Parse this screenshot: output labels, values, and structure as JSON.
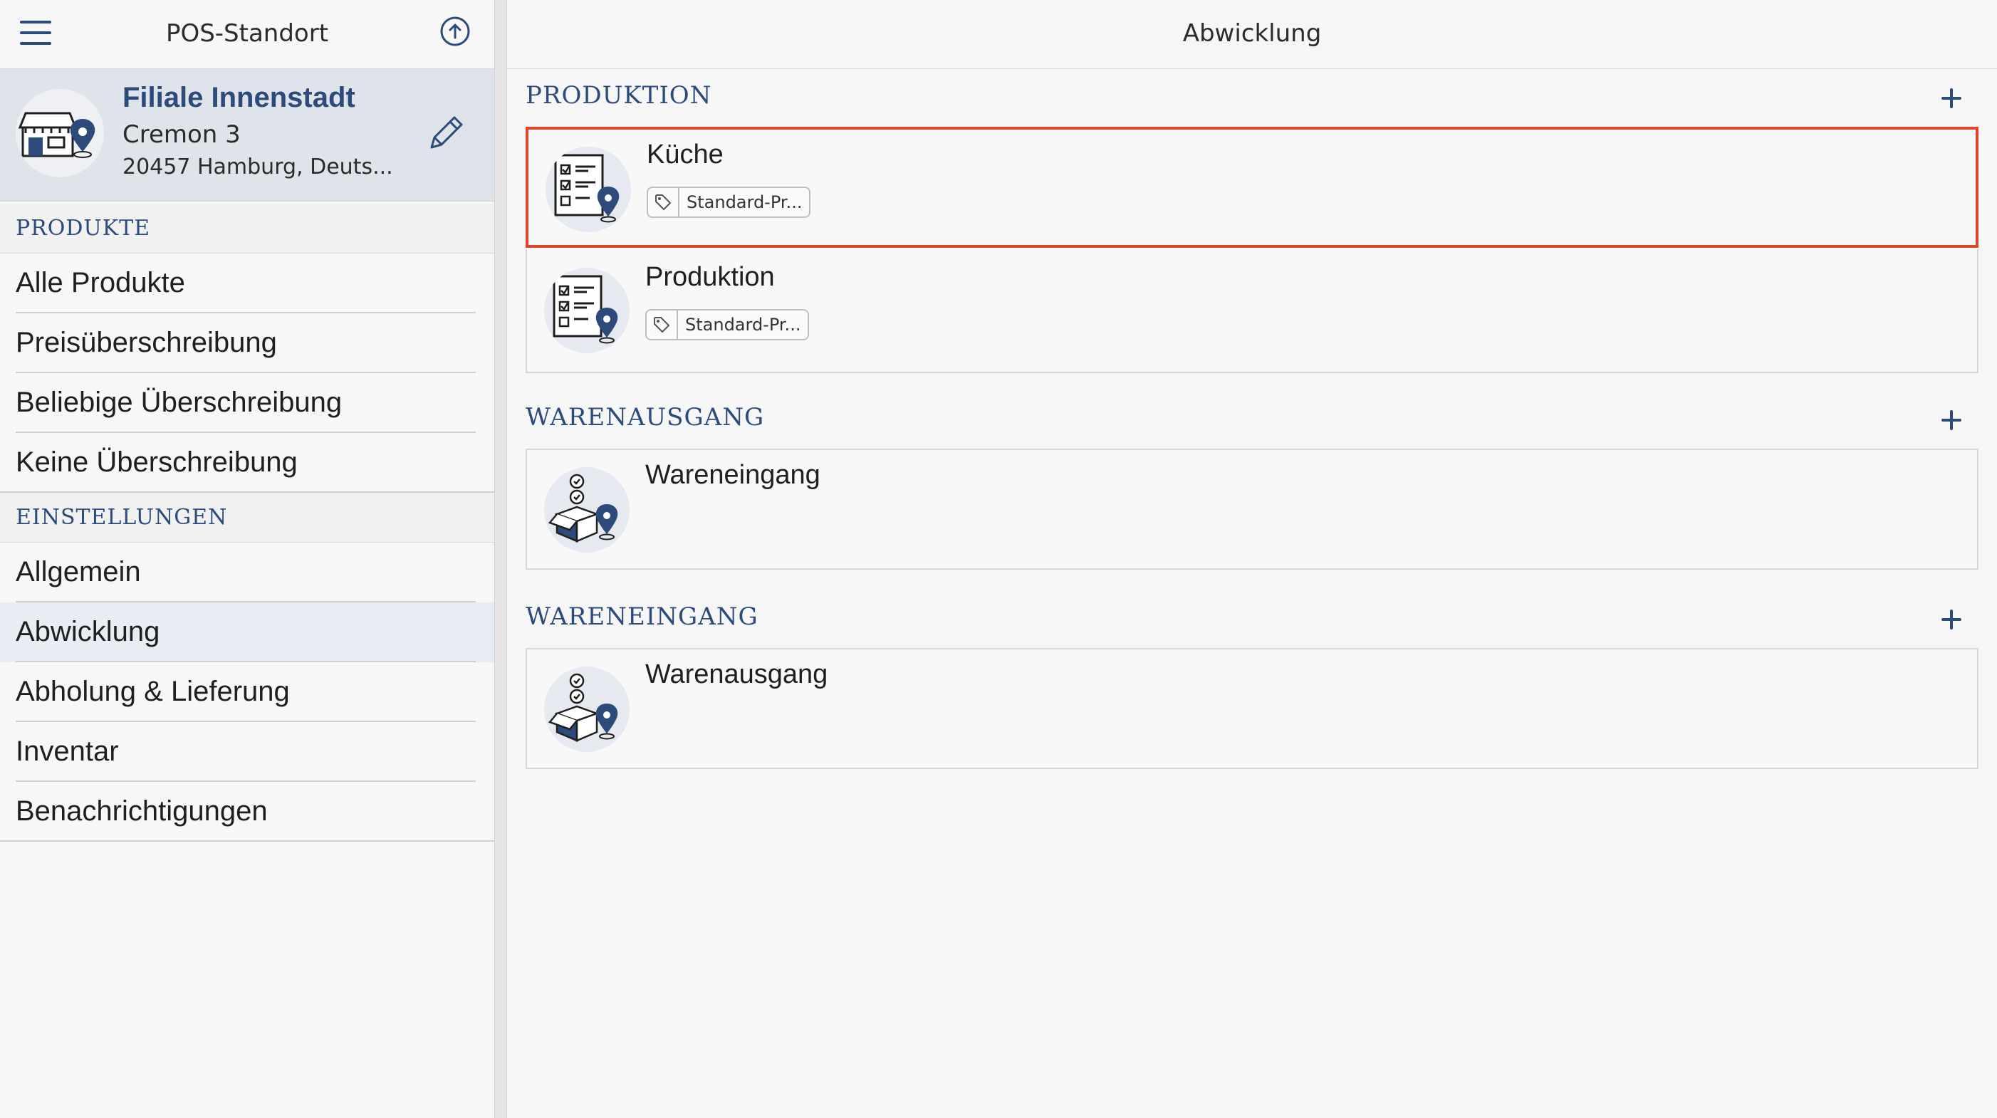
{
  "sidebar": {
    "title": "POS-Standort",
    "store": {
      "name": "Filiale Innenstadt",
      "street": "Cremon 3",
      "city": "20457 Hamburg, Deuts..."
    },
    "sections": [
      {
        "label": "PRODUKTE",
        "items": [
          "Alle Produkte",
          "Preisüberschreibung",
          "Beliebige Überschreibung",
          "Keine Überschreibung"
        ]
      },
      {
        "label": "EINSTELLUNGEN",
        "items": [
          "Allgemein",
          "Abwicklung",
          "Abholung & Lieferung",
          "Inventar",
          "Benachrichtigungen"
        ]
      }
    ],
    "active_item": "Abwicklung"
  },
  "main": {
    "title": "Abwicklung",
    "groups": [
      {
        "title": "PRODUKTION",
        "items": [
          {
            "title": "Küche",
            "tag": "Standard-Pr...",
            "icon": "checklist-location-icon",
            "selected": true
          },
          {
            "title": "Produktion",
            "tag": "Standard-Pr...",
            "icon": "checklist-location-icon",
            "selected": false
          }
        ]
      },
      {
        "title": "WARENAUSGANG",
        "items": [
          {
            "title": "Wareneingang",
            "icon": "box-location-icon"
          }
        ]
      },
      {
        "title": "WARENEINGANG",
        "items": [
          {
            "title": "Warenausgang",
            "icon": "box-location-icon"
          }
        ]
      }
    ]
  },
  "colors": {
    "accent": "#2c4a7a",
    "selection_border": "#e0442c",
    "active_nav_bg": "#e8ecf3"
  }
}
